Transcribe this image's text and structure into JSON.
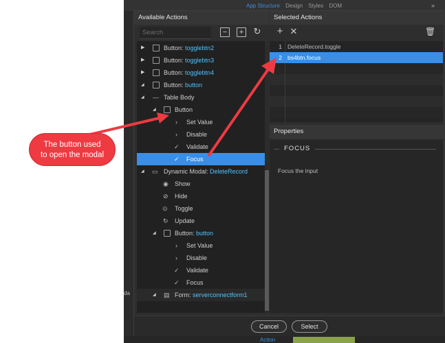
{
  "top_bar": {
    "tabs": [
      "App Structure",
      "Design",
      "Styles",
      "DOM"
    ],
    "chevrons": "»"
  },
  "available_actions": {
    "title": "Available Actions",
    "search_placeholder": "Search",
    "tree": [
      {
        "label": "Button: ",
        "name": "togglebtn2"
      },
      {
        "label": "Button: ",
        "name": "togglebtn3"
      },
      {
        "label": "Button: ",
        "name": "togglebtn4"
      },
      {
        "label": "Button: ",
        "name": "button"
      },
      {
        "label": "Table Body",
        "name": ""
      },
      {
        "label": "Button",
        "name": ""
      },
      {
        "label": "Set Value",
        "name": ""
      },
      {
        "label": "Disable",
        "name": ""
      },
      {
        "label": "Validate",
        "name": ""
      },
      {
        "label": "Focus",
        "name": ""
      },
      {
        "label": "Dynamic Modal: ",
        "name": "DeleteRecord"
      },
      {
        "label": "Show",
        "name": ""
      },
      {
        "label": "Hide",
        "name": ""
      },
      {
        "label": "Toggle",
        "name": ""
      },
      {
        "label": "Update",
        "name": ""
      },
      {
        "label": "Button: ",
        "name": "button"
      },
      {
        "label": "Set Value",
        "name": ""
      },
      {
        "label": "Disable",
        "name": ""
      },
      {
        "label": "Validate",
        "name": ""
      },
      {
        "label": "Focus",
        "name": ""
      },
      {
        "label": "Form: ",
        "name": "serverconnectform1"
      }
    ],
    "selected_index": 9
  },
  "selected_actions": {
    "title": "Selected Actions",
    "items": [
      {
        "num": "1",
        "text": "DeleteRecord.toggle"
      },
      {
        "num": "2",
        "text": "bs4btn.focus"
      }
    ],
    "selected_index": 1
  },
  "properties": {
    "title": "Properties",
    "section_title": "FOCUS",
    "description": "Focus the input"
  },
  "footer": {
    "cancel_label": "Cancel",
    "select_label": "Select"
  },
  "callout": {
    "line1": "The button used",
    "line2": "to open the modal"
  },
  "edge_text": "da",
  "bottom": {
    "action_label": "Action"
  },
  "colors": {
    "selection": "#3a8ee6",
    "callout": "#ef3a42",
    "highlight_name": "#4fc3ff"
  }
}
